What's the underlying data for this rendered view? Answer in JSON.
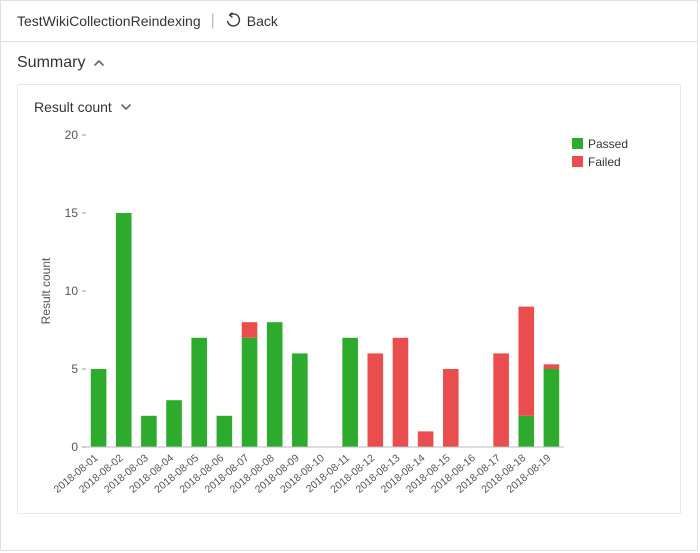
{
  "header": {
    "title": "TestWikiCollectionReindexing",
    "back_label": "Back"
  },
  "summary": {
    "label": "Summary"
  },
  "card": {
    "title": "Result count"
  },
  "chart_data": {
    "type": "bar",
    "stacked": true,
    "title": "",
    "xlabel": "",
    "ylabel": "Result count",
    "ylim": [
      0,
      20
    ],
    "yticks": [
      0,
      5,
      10,
      15,
      20
    ],
    "categories": [
      "2018-08-01",
      "2018-08-02",
      "2018-08-03",
      "2018-08-04",
      "2018-08-05",
      "2018-08-06",
      "2018-08-07",
      "2018-08-08",
      "2018-08-09",
      "2018-08-10",
      "2018-08-11",
      "2018-08-12",
      "2018-08-13",
      "2018-08-14",
      "2018-08-15",
      "2018-08-16",
      "2018-08-17",
      "2018-08-18",
      "2018-08-19"
    ],
    "series": [
      {
        "name": "Passed",
        "color": "#2cab2c",
        "values": [
          5,
          15,
          2,
          3,
          7,
          2,
          7,
          8,
          6,
          0,
          7,
          0,
          0,
          0,
          0,
          0,
          0,
          2,
          5
        ]
      },
      {
        "name": "Failed",
        "color": "#e94d4d",
        "values": [
          0,
          0,
          0,
          0,
          0,
          0,
          1,
          0,
          0,
          0,
          0,
          6,
          7,
          1,
          5,
          0,
          6,
          7,
          0.3
        ]
      }
    ],
    "legend_position": "top-right"
  }
}
